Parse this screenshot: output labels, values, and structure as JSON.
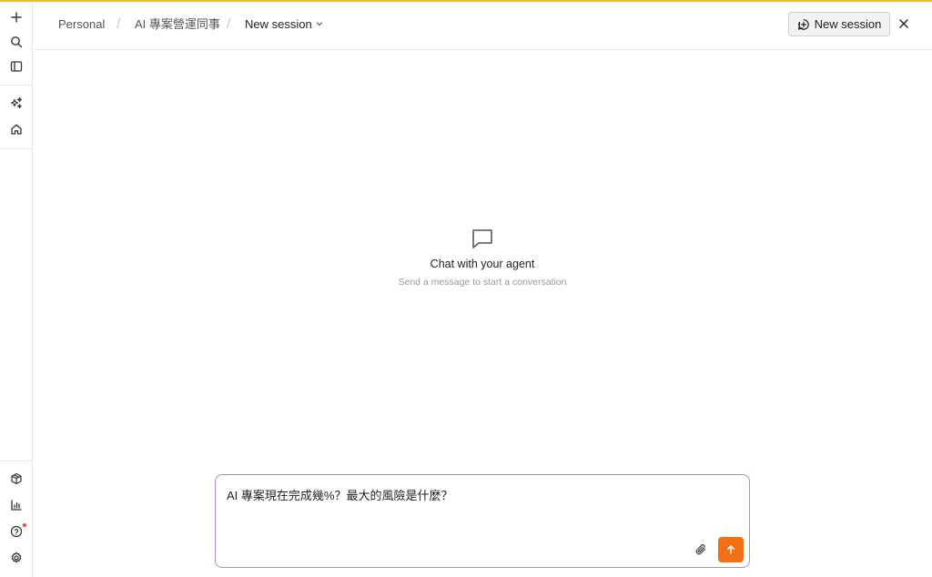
{
  "colors": {
    "accent_top": "#f5b82e",
    "composer_border": "#a48ae6",
    "send_button": "#f36f15",
    "notification_dot": "#e5484d"
  },
  "rail": {
    "top_icons": [
      "plus-icon",
      "search-icon",
      "sidebar-toggle-icon"
    ],
    "middle_icons": [
      "sparkles-icon",
      "home-icon"
    ],
    "bottom_icons": [
      "cube-icon",
      "bar-chart-icon",
      "help-icon",
      "settings-icon"
    ]
  },
  "header": {
    "breadcrumbs": [
      "Personal",
      "AI 專案營運同事",
      "New session"
    ],
    "new_session_label": "New session"
  },
  "empty_state": {
    "title": "Chat with your agent",
    "subtitle": "Send a message to start a conversation"
  },
  "composer": {
    "value": "AI 專案現在完成幾%？最大的風險是什麼？"
  }
}
